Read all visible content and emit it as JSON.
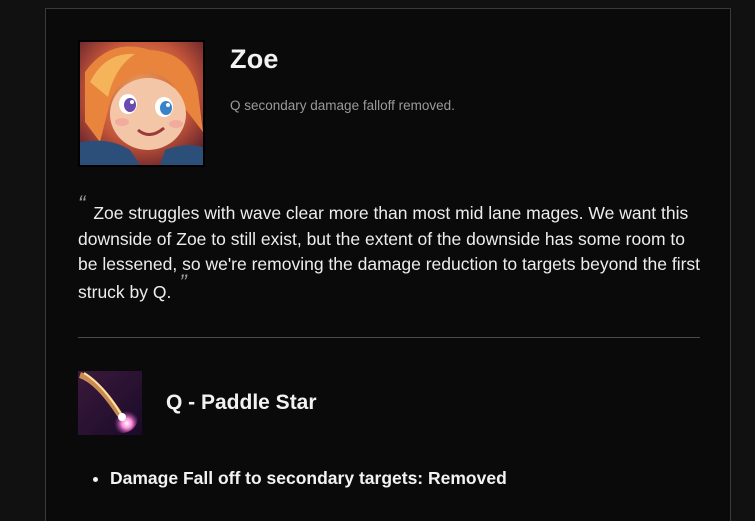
{
  "champion": {
    "name": "Zoe",
    "summary": "Q secondary damage falloff removed.",
    "portrait_icon": "zoe-portrait-icon"
  },
  "quote": {
    "open_mark": "“",
    "text": "Zoe struggles with wave clear more than most mid lane mages. We want this downside of Zoe to still exist, but the extent of the downside has some room to be lessened, so we're removing the damage reduction to targets beyond the first struck by Q.",
    "close_mark": "”"
  },
  "ability": {
    "title": "Q - Paddle Star",
    "icon": "paddle-star-icon",
    "changes": [
      "Damage Fall off to secondary targets: Removed"
    ]
  },
  "colors": {
    "background": "#111111",
    "card": "#0a0a0a",
    "border": "#3a3a3a",
    "text": "#f2f2f2",
    "muted": "#9a9a9a"
  }
}
